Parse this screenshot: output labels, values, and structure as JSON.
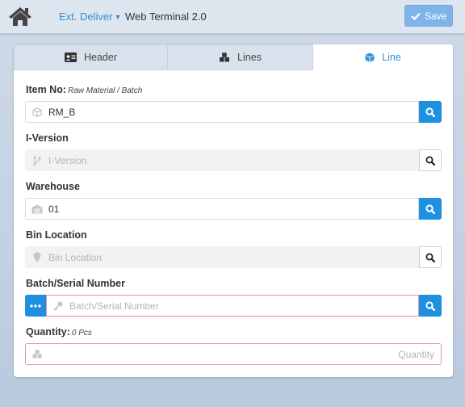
{
  "topbar": {
    "module": "Ext. Deliver",
    "title": "Web Terminal 2.0",
    "save_label": "Save"
  },
  "tabs": [
    {
      "label": "Header",
      "icon": "id-card-icon",
      "active": false
    },
    {
      "label": "Lines",
      "icon": "cubes-icon",
      "active": false
    },
    {
      "label": "Line",
      "icon": "cube-icon",
      "active": true
    }
  ],
  "fields": {
    "item_no": {
      "label": "Item No:",
      "hint": "Raw Material / Batch",
      "value": "RM_B"
    },
    "iversion": {
      "label": "I-Version",
      "placeholder": "I-Version"
    },
    "warehouse": {
      "label": "Warehouse",
      "value": "01"
    },
    "bin_location": {
      "label": "Bin Location",
      "placeholder": "Bin Location"
    },
    "batch_serial": {
      "label": "Batch/Serial Number",
      "placeholder": "Batch/Serial Number"
    },
    "quantity": {
      "label": "Quantity:",
      "hint": "0 Pcs",
      "placeholder": "Quantity"
    }
  },
  "colors": {
    "accent": "#1f8fe0",
    "save": "#7fb4ea",
    "error_border": "#d99aa6"
  }
}
